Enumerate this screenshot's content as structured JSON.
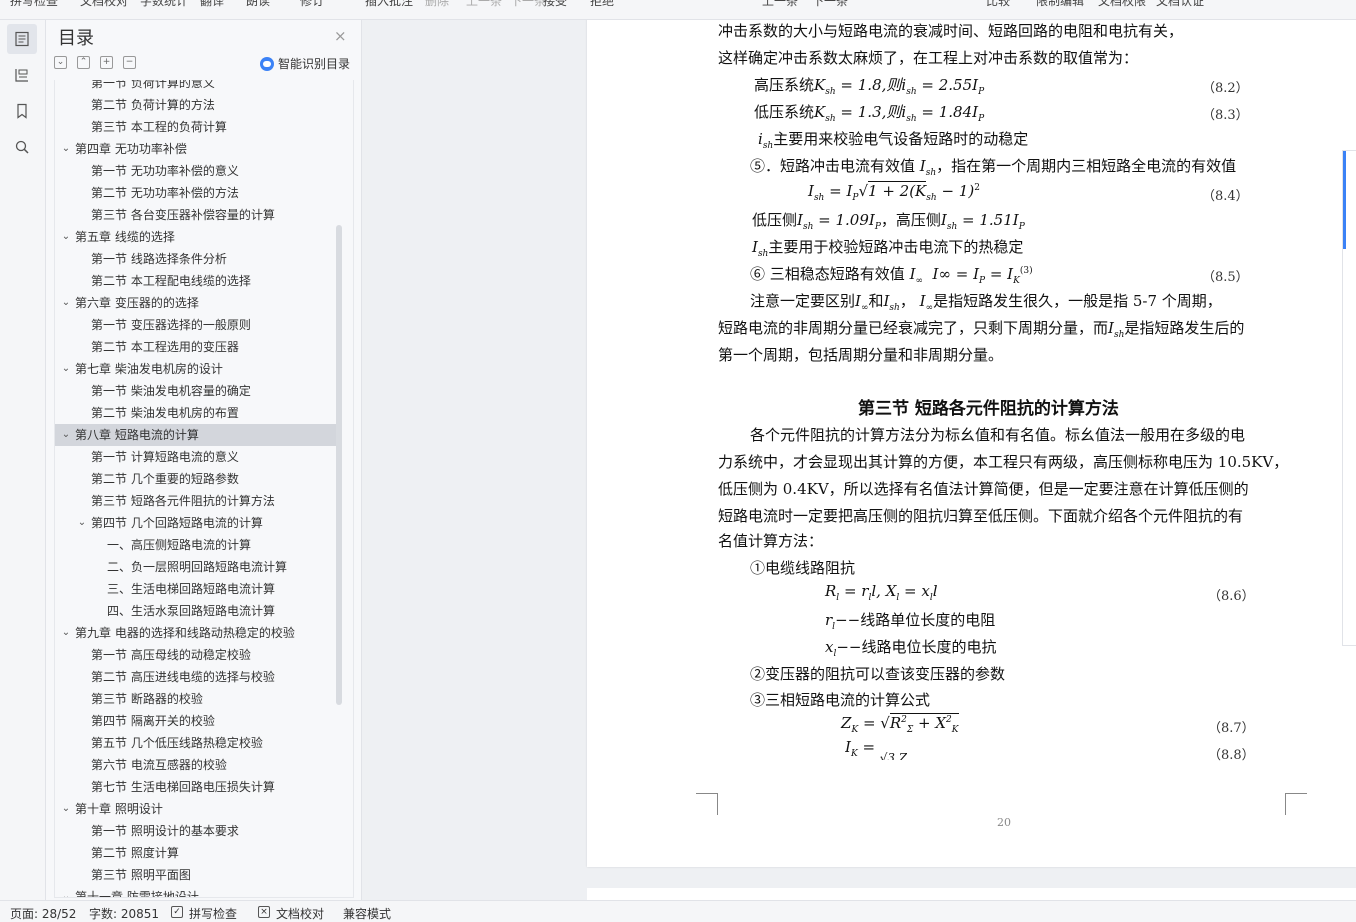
{
  "toolbar": {
    "items": [
      "拼写检查",
      "文档校对",
      "字数统计",
      "翻译",
      "朗读",
      "修订",
      "插入批注",
      "删除",
      "上一条",
      "下一条",
      "接受",
      "拒绝",
      "上一条",
      "下一条",
      "比较",
      "限制编辑",
      "文档权限",
      "文档认证"
    ]
  },
  "rail": {
    "icons": [
      "toc-icon",
      "outline-icon",
      "bookmark-icon",
      "search-icon"
    ]
  },
  "toc": {
    "title": "目录",
    "close_glyph": "×",
    "smart_label": "智能识别目录",
    "items": [
      {
        "level": 2,
        "text": "第一节 负荷计算的意义"
      },
      {
        "level": 2,
        "text": "第二节 负荷计算的方法"
      },
      {
        "level": 2,
        "text": "第三节 本工程的负荷计算"
      },
      {
        "level": 1,
        "text": "第四章 无功功率补偿",
        "chevron": "v"
      },
      {
        "level": 2,
        "text": "第一节 无功功率补偿的意义"
      },
      {
        "level": 2,
        "text": "第二节 无功功率补偿的方法"
      },
      {
        "level": 2,
        "text": "第三节 各台变压器补偿容量的计算"
      },
      {
        "level": 1,
        "text": "第五章 线缆的选择",
        "chevron": "v"
      },
      {
        "level": 2,
        "text": "第一节 线路选择条件分析"
      },
      {
        "level": 2,
        "text": "第二节 本工程配电线缆的选择"
      },
      {
        "level": 1,
        "text": "第六章 变压器的的选择",
        "chevron": "v"
      },
      {
        "level": 2,
        "text": "第一节 变压器选择的一般原则"
      },
      {
        "level": 2,
        "text": "第二节 本工程选用的变压器"
      },
      {
        "level": 1,
        "text": "第七章 柴油发电机房的设计",
        "chevron": "v"
      },
      {
        "level": 2,
        "text": "第一节 柴油发电机容量的确定"
      },
      {
        "level": 2,
        "text": "第二节 柴油发电机房的布置"
      },
      {
        "level": 1,
        "text": "第八章 短路电流的计算",
        "chevron": "v",
        "selected": true
      },
      {
        "level": 2,
        "text": "第一节 计算短路电流的意义"
      },
      {
        "level": 2,
        "text": "第二节 几个重要的短路参数"
      },
      {
        "level": 2,
        "text": "第三节 短路各元件阻抗的计算方法"
      },
      {
        "level": 2,
        "text": "第四节 几个回路短路电流的计算",
        "chevron": "v"
      },
      {
        "level": 3,
        "text": "一、高压侧短路电流的计算"
      },
      {
        "level": 3,
        "text": "二、负一层照明回路短路电流计算"
      },
      {
        "level": 3,
        "text": "三、生活电梯回路短路电流计算"
      },
      {
        "level": 3,
        "text": "四、生活水泵回路短路电流计算"
      },
      {
        "level": 1,
        "text": "第九章 电器的选择和线路动热稳定的校验",
        "chevron": "v"
      },
      {
        "level": 2,
        "text": "第一节 高压母线的动稳定校验"
      },
      {
        "level": 2,
        "text": "第二节 高压进线电缆的选择与校验"
      },
      {
        "level": 2,
        "text": "第三节 断路器的校验"
      },
      {
        "level": 2,
        "text": "第四节 隔离开关的校验"
      },
      {
        "level": 2,
        "text": "第五节 几个低压线路热稳定校验"
      },
      {
        "level": 2,
        "text": "第六节 电流互感器的校验"
      },
      {
        "level": 2,
        "text": "第七节 生活电梯回路电压损失计算"
      },
      {
        "level": 1,
        "text": "第十章 照明设计",
        "chevron": "v"
      },
      {
        "level": 2,
        "text": "第一节 照明设计的基本要求"
      },
      {
        "level": 2,
        "text": "第二节 照度计算"
      },
      {
        "level": 2,
        "text": "第三节 照明平面图"
      },
      {
        "level": 1,
        "text": "第十一章 防雷接地设计",
        "chevron": "v"
      }
    ]
  },
  "doc": {
    "para1_l1": "冲击系数的大小与短路电流的衰减时间、短路回路的电阻和电抗有关，",
    "para1_l2": "这样确定冲击系数太麻烦了，在工程上对冲击系数的取值常为：",
    "eq_82_prefix": "高压系统",
    "eq_82_body": "K",
    "eq_82_rest": " = 1.8,则",
    "eq_82_i": "i",
    "eq_82_val": " = 2.55I",
    "eq_82_num": "（8.2）",
    "eq_83_prefix": "低压系统",
    "eq_83_rest": " = 1.3,则",
    "eq_83_val": " = 1.84I",
    "eq_83_num": "（8.3）",
    "ish_note": "主要用来校验电气设备短路时的动稳定",
    "item5": "⑤．短路冲击电流有效值",
    "item5_tail": "，指在第一个周期内三相短路全电流的有效值",
    "eq_84": "I",
    "eq_84_body": " = I",
    "eq_84_sqrt": "1 + 2(K",
    "eq_84_end": " − 1)",
    "eq_84_num": "（8.4）",
    "low_side": "低压侧",
    "low_val": " = 1.09I",
    "high_side": "，高压侧",
    "high_val": " = 1.51I",
    "Ish_note": "主要用于校验短路冲击电流下的热稳定",
    "item6": "⑥ 三相稳态短路有效值",
    "item6_eq": "I∞ = I",
    "item6_eq2": " = I",
    "eq_85_num": "（8.5）",
    "note_l1_a": "注意一定要区别",
    "note_l1_b": "和",
    "note_l1_c": "，",
    "note_l1_d": "是指短路发生很久，一般是指 5-7 个周期，",
    "note_l2_a": "短路电流的非周期分量已经衰减完了，只剩下周期分量，而",
    "note_l2_b": "是指短路发生后的",
    "note_l3": "第一个周期，包括周期分量和非周期分量。",
    "heading": "第三节 短路各元件阻抗的计算方法",
    "body_l1": "各个元件阻抗的计算方法分为标幺值和有名值。标幺值法一般用在多级的电",
    "body_l2": "力系统中，才会显现出其计算的方便，本工程只有两级，高压侧标称电压为 10.5KV，",
    "body_l3": "低压侧为 0.4KV，所以选择有名值法计算简便，但是一定要注意在计算低压侧的",
    "body_l4": "短路电流时一定要把高压侧的阻抗归算至低压侧。下面就介绍各个元件阻抗的有",
    "body_l5": "名值计算方法：",
    "sub1": "①电缆线路阻抗",
    "eq_86": "R",
    "eq_86_a": " = r",
    "eq_86_b": "l, X",
    "eq_86_c": " = x",
    "eq_86_d": "l",
    "eq_86_num": "（8.6）",
    "r_def": "−−线路单位长度的电阻",
    "x_def": "−−线路电位长度的电抗",
    "sub2": "②变压器的阻抗可以查该变压器的参数",
    "sub3": "③三相短路电流的计算公式",
    "eq_87_num": "（8.7）",
    "eq_88_num": "（8.8）",
    "page_number": "20"
  },
  "status": {
    "page": "页面: 28/52",
    "words": "字数: 20851",
    "spell": "拼写检查",
    "proof": "文档校对",
    "compat": "兼容模式"
  }
}
